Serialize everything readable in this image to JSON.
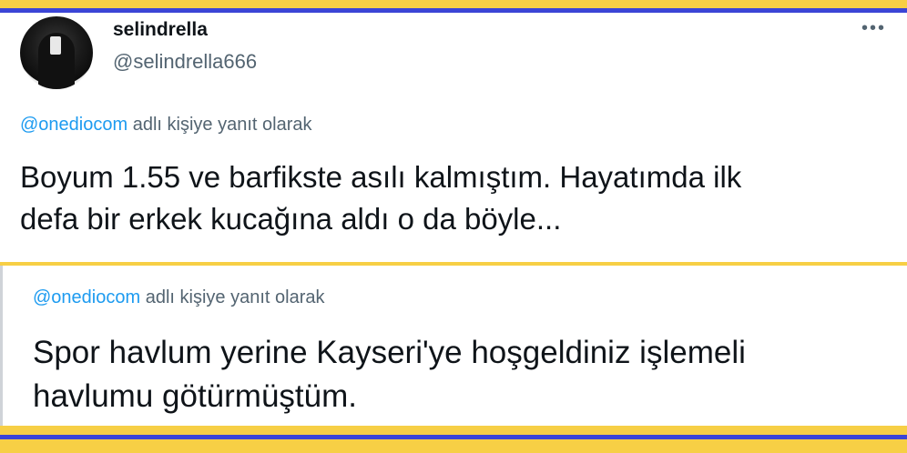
{
  "tweets": [
    {
      "display_name": "selindrella",
      "handle": "@selindrella666",
      "more_icon": "more-horizontal-icon",
      "reply": {
        "mention": "@onediocom",
        "suffix": " adlı kişiye yanıt olarak"
      },
      "text_lines": [
        "Boyum 1.55 ve barfikste asılı kalmıştım. Hayatımda ilk",
        "defa bir erkek kucağına aldı o da böyle..."
      ]
    },
    {
      "reply": {
        "mention": "@onediocom",
        "suffix": " adlı kişiye yanıt olarak"
      },
      "text_lines": [
        "Spor havlum yerine Kayseri'ye hoşgeldiniz işlemeli",
        "havlumu götürmüştüm."
      ]
    }
  ],
  "colors": {
    "border_yellow": "#f7cf45",
    "stripe_blue": "#3b45d6",
    "mention_blue": "#1d9bf0",
    "muted_gray": "#536471",
    "text": "#0f1419"
  }
}
